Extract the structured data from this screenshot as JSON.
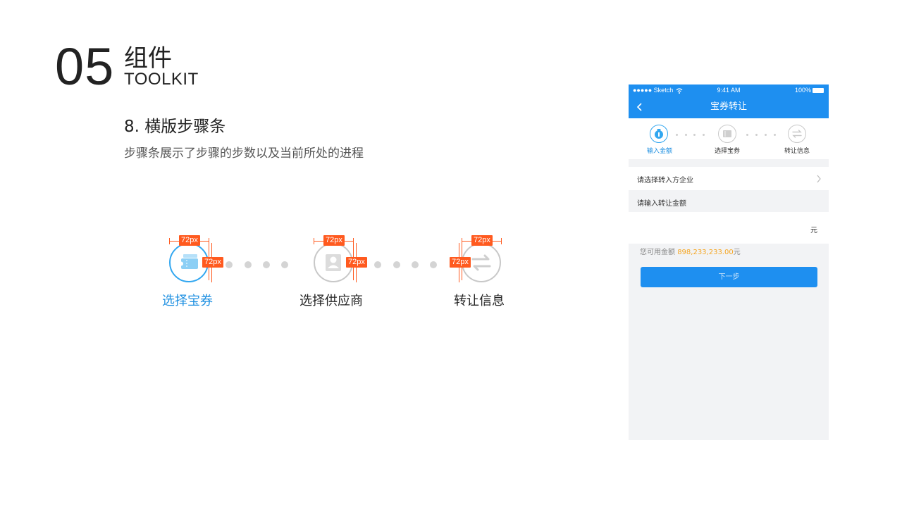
{
  "header": {
    "number": "05",
    "title_cn": "组件",
    "title_en": "TOOLKIT"
  },
  "section": {
    "title": "8.  横版步骤条",
    "description": "步骤条展示了步骤的步数以及当前所处的进程"
  },
  "stepper": {
    "steps": [
      {
        "label": "选择宝券",
        "icon": "ticket-icon",
        "active": true
      },
      {
        "label": "选择供应商",
        "icon": "person-icon",
        "active": false
      },
      {
        "label": "转让信息",
        "icon": "transfer-arrows-icon",
        "active": false
      }
    ],
    "dimension_label": "72px"
  },
  "phone": {
    "status": {
      "carrier": "●●●●● Sketch",
      "time": "9:41 AM",
      "battery": "100%"
    },
    "nav_title": "宝券转让",
    "steps": [
      {
        "label": "输入金额",
        "icon": "money-bag-icon",
        "active": true
      },
      {
        "label": "选择宝券",
        "icon": "ticket-icon",
        "active": false
      },
      {
        "label": "转让信息",
        "icon": "transfer-arrows-icon",
        "active": false
      }
    ],
    "select_company_placeholder": "请选择转入方企业",
    "amount_section_label": "请输入转让金额",
    "amount_unit": "元",
    "available_prefix": "您可用金额 ",
    "available_amount": "898,233,233.00",
    "available_suffix": "元",
    "next_button": "下一步"
  },
  "colors": {
    "brand_blue": "#1e8ff0",
    "active_blue": "#32a7f0",
    "measure_orange": "#ff5a1f",
    "amount_orange": "#f5a623"
  }
}
